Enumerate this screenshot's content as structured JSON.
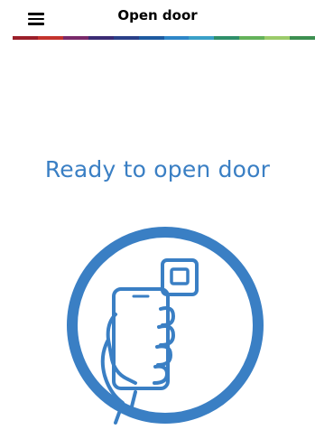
{
  "header": {
    "title": "Open door",
    "menu_icon": "hamburger-menu-icon"
  },
  "brand_bar": {
    "colors": [
      "#9b1f2a",
      "#c4332d",
      "#7a2a6a",
      "#3b2b74",
      "#2a3f88",
      "#1e5aa0",
      "#2e86c8",
      "#3aa0c8",
      "#2f8f6a",
      "#64b25a",
      "#9bcb6a",
      "#3d8f50"
    ]
  },
  "main": {
    "heading": "Ready to open door",
    "illustration_icon": "hand-holding-phone-near-reader-icon",
    "accent_color": "#3a7fc4"
  }
}
